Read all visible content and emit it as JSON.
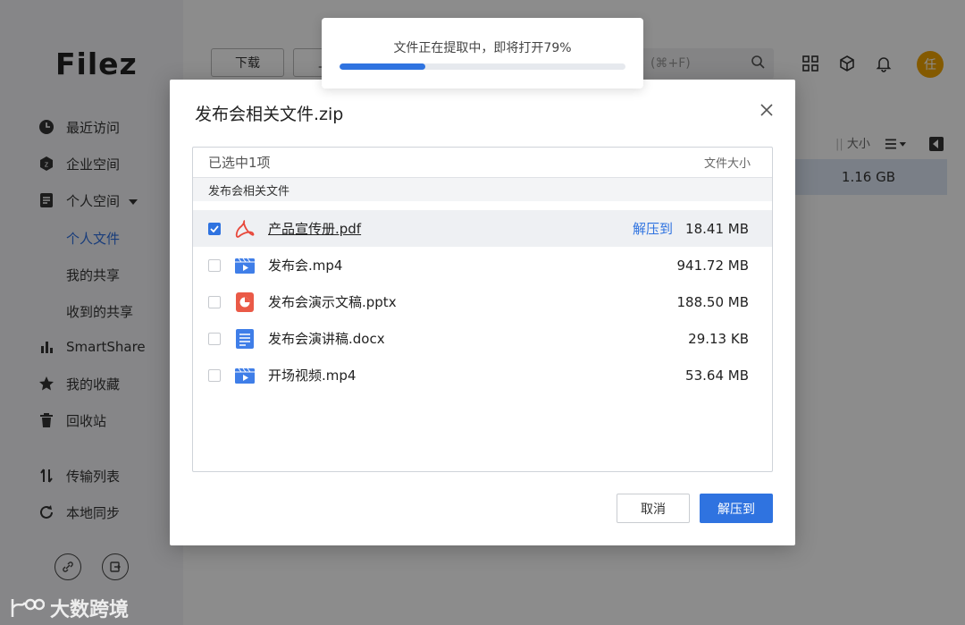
{
  "app": {
    "logo": "Filez",
    "nav": [
      {
        "label": "最近访问",
        "icon": "clock-icon"
      },
      {
        "label": "企业空间",
        "icon": "enterprise-icon"
      },
      {
        "label": "个人空间",
        "icon": "document-icon"
      },
      {
        "label": "SmartShare",
        "icon": "bar-chart-icon"
      },
      {
        "label": "我的收藏",
        "icon": "star-icon"
      },
      {
        "label": "回收站",
        "icon": "trash-icon"
      },
      {
        "label": "传输列表",
        "icon": "transfer-icon"
      },
      {
        "label": "本地同步",
        "icon": "sync-icon"
      }
    ],
    "sub_nav": [
      "个人文件",
      "我的共享",
      "收到的共享"
    ],
    "toolbar": {
      "download": "下载",
      "second_button": "上"
    },
    "search": {
      "shortcut": "(⌘+F)"
    },
    "avatar_text": "任",
    "column_header": "大小",
    "background_row_size": "1.16 GB",
    "accent_color": "#2f73e0"
  },
  "toast": {
    "message": "文件正在提取中，即将打开79%",
    "progress_percent": 79,
    "progress_fill_percent": 30
  },
  "modal": {
    "title": "发布会相关文件.zip",
    "selected_count": "已选中1项",
    "size_header": "文件大小",
    "folder": "发布会相关文件",
    "extract_link": "解压到",
    "files": [
      {
        "name": "产品宣传册.pdf",
        "size": "18.41 MB",
        "icon": "pdf-icon",
        "checked": true
      },
      {
        "name": "发布会.mp4",
        "size": "941.72 MB",
        "icon": "video-icon",
        "checked": false
      },
      {
        "name": "发布会演示文稿.pptx",
        "size": "188.50 MB",
        "icon": "ppt-icon",
        "checked": false
      },
      {
        "name": "发布会演讲稿.docx",
        "size": "29.13 KB",
        "icon": "doc-icon",
        "checked": false
      },
      {
        "name": "开场视频.mp4",
        "size": "53.64 MB",
        "icon": "video-icon",
        "checked": false
      }
    ],
    "cancel": "取消",
    "confirm": "解压到"
  },
  "watermark": "大数跨境"
}
